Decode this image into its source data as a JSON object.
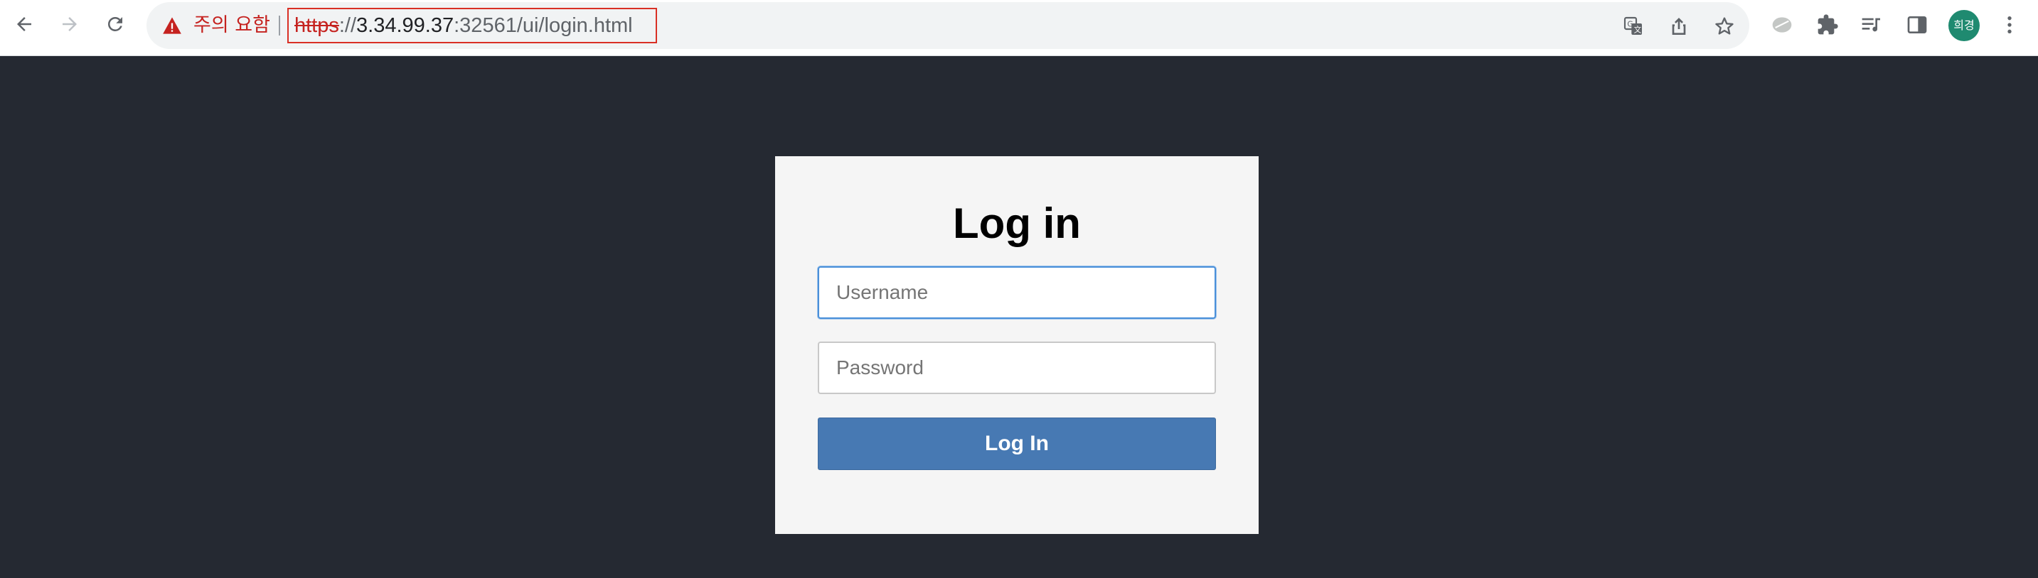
{
  "browser": {
    "security_warning": "주의 요함",
    "url": {
      "scheme": "https",
      "separator": "://",
      "host": "3.34.99.37",
      "rest": ":32561/ui/login.html"
    },
    "profile_initials": "희경"
  },
  "login": {
    "title": "Log in",
    "username_placeholder": "Username",
    "password_placeholder": "Password",
    "submit_label": "Log In"
  },
  "colors": {
    "page_background": "#252932",
    "card_background": "#f5f5f5",
    "button": "#4779b3",
    "warning": "#c5221f"
  }
}
